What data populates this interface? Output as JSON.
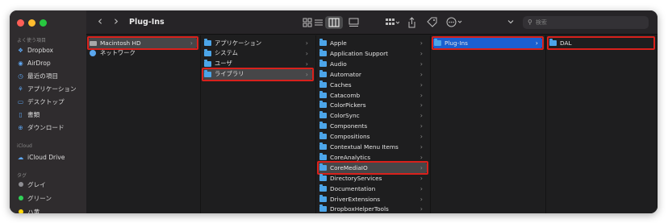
{
  "window": {
    "title": "Plug-Ins"
  },
  "toolbar": {
    "search_placeholder": "検索",
    "back": "‹",
    "forward": "›"
  },
  "sidebar": {
    "favorites_header": "よく使う項目",
    "favorites": [
      {
        "label": "Dropbox",
        "icon": "dropbox-icon"
      },
      {
        "label": "AirDrop",
        "icon": "airdrop-icon"
      },
      {
        "label": "最近の項目",
        "icon": "clock-icon"
      },
      {
        "label": "アプリケーション",
        "icon": "applications-icon"
      },
      {
        "label": "デスクトップ",
        "icon": "desktop-icon"
      },
      {
        "label": "書類",
        "icon": "document-icon"
      },
      {
        "label": "ダウンロード",
        "icon": "download-icon"
      }
    ],
    "icloud_header": "iCloud",
    "icloud": [
      {
        "label": "iCloud Drive",
        "icon": "cloud-icon"
      }
    ],
    "tags_header": "タグ",
    "tags": [
      {
        "label": "グレイ",
        "color": "#8e8e93"
      },
      {
        "label": "グリーン",
        "color": "#30d158"
      },
      {
        "label": "ハ黄",
        "color": "#ffd60a"
      }
    ]
  },
  "columns": [
    {
      "items": [
        {
          "label": "Macintosh HD",
          "kind": "disk",
          "selected": "gray",
          "arrow": true,
          "highlighted": true
        },
        {
          "label": "ネットワーク",
          "kind": "network",
          "arrow": false
        }
      ]
    },
    {
      "items": [
        {
          "label": "アプリケーション",
          "kind": "folder",
          "arrow": true
        },
        {
          "label": "システム",
          "kind": "folder",
          "arrow": true
        },
        {
          "label": "ユーザ",
          "kind": "folder",
          "arrow": true
        },
        {
          "label": "ライブラリ",
          "kind": "folder",
          "selected": "gray",
          "arrow": true,
          "highlighted": true
        }
      ]
    },
    {
      "items": [
        {
          "label": "Apple",
          "kind": "folder",
          "arrow": true
        },
        {
          "label": "Application Support",
          "kind": "folder",
          "arrow": true
        },
        {
          "label": "Audio",
          "kind": "folder",
          "arrow": true
        },
        {
          "label": "Automator",
          "kind": "folder",
          "arrow": true
        },
        {
          "label": "Caches",
          "kind": "folder",
          "arrow": true
        },
        {
          "label": "Catacomb",
          "kind": "folder",
          "arrow": true
        },
        {
          "label": "ColorPickers",
          "kind": "folder",
          "arrow": true
        },
        {
          "label": "ColorSync",
          "kind": "folder",
          "arrow": true
        },
        {
          "label": "Components",
          "kind": "folder",
          "arrow": true
        },
        {
          "label": "Compositions",
          "kind": "folder",
          "arrow": true
        },
        {
          "label": "Contextual Menu Items",
          "kind": "folder",
          "arrow": true
        },
        {
          "label": "CoreAnalytics",
          "kind": "folder",
          "arrow": true
        },
        {
          "label": "CoreMediaIO",
          "kind": "folder",
          "selected": "gray",
          "arrow": true,
          "highlighted": true
        },
        {
          "label": "DirectoryServices",
          "kind": "folder",
          "arrow": true
        },
        {
          "label": "Documentation",
          "kind": "folder",
          "arrow": true
        },
        {
          "label": "DriverExtensions",
          "kind": "folder",
          "arrow": true
        },
        {
          "label": "DropboxHelperTools",
          "kind": "folder",
          "arrow": true
        }
      ]
    },
    {
      "items": [
        {
          "label": "Plug-Ins",
          "kind": "folder",
          "selected": "blue",
          "arrow": true,
          "highlighted": true
        }
      ]
    },
    {
      "items": [
        {
          "label": "DAL",
          "kind": "folder",
          "arrow": false,
          "highlighted": true
        }
      ]
    }
  ],
  "colors": {
    "selection_blue": "#1a5fd0",
    "selection_gray": "#464648",
    "highlight_red": "#d8211c",
    "folder_blue": "#4ca5e9"
  }
}
